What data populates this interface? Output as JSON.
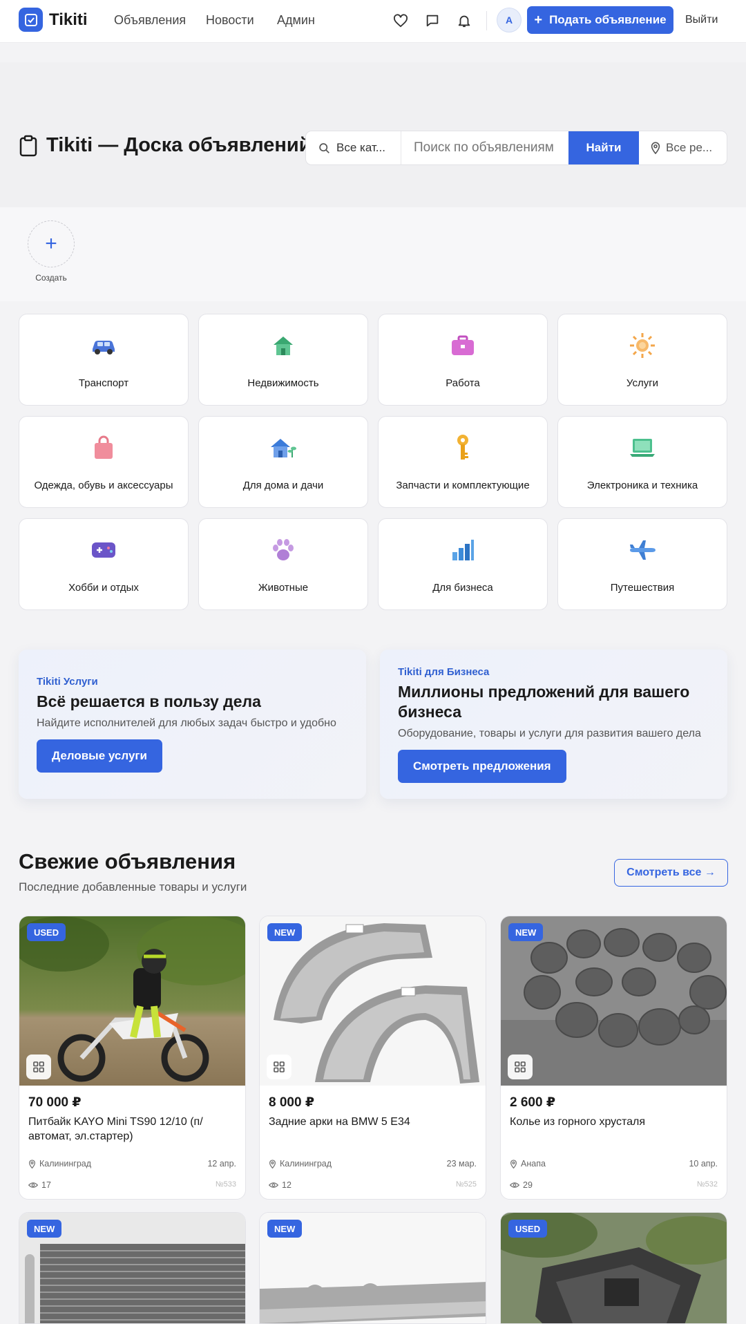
{
  "header": {
    "logo": "Tikiti",
    "nav": [
      "Объявления",
      "Новости",
      "Админ"
    ],
    "avatar": "A",
    "post_button": "Подать объявление",
    "logout": "Выйти"
  },
  "hero": {
    "title": "Tikiti — Доска объявлений",
    "category_select": "Все кат...",
    "search_placeholder": "Поиск по объявлениям",
    "find_button": "Найти",
    "region_select": "Все ре..."
  },
  "stories": {
    "create_label": "Создать"
  },
  "categories": [
    {
      "label": "Транспорт",
      "icon": "car-icon"
    },
    {
      "label": "Недвижимость",
      "icon": "house-icon"
    },
    {
      "label": "Работа",
      "icon": "briefcase-icon"
    },
    {
      "label": "Услуги",
      "icon": "sun-icon"
    },
    {
      "label": "Одежда, обувь и аксессуары",
      "icon": "bag-icon"
    },
    {
      "label": "Для дома и дачи",
      "icon": "garden-house-icon"
    },
    {
      "label": "Запчасти и комплектующие",
      "icon": "key-icon"
    },
    {
      "label": "Электроника и техника",
      "icon": "laptop-icon"
    },
    {
      "label": "Хобби и отдых",
      "icon": "gamepad-icon"
    },
    {
      "label": "Животные",
      "icon": "paw-icon"
    },
    {
      "label": "Для бизнеса",
      "icon": "bar-chart-icon"
    },
    {
      "label": "Путешествия",
      "icon": "airplane-icon"
    }
  ],
  "promos": [
    {
      "tag": "Tikiti Услуги",
      "heading": "Всё решается в пользу дела",
      "desc": "Найдите исполнителей для любых задач быстро и удобно",
      "button": "Деловые услуги"
    },
    {
      "tag": "Tikiti для Бизнеса",
      "heading": "Миллионы предложений для вашего бизнеса",
      "desc": "Оборудование, товары и услуги для развития вашего дела",
      "button": "Смотреть предложения"
    }
  ],
  "fresh": {
    "title": "Свежие объявления",
    "subtitle": "Последние добавленные товары и услуги",
    "see_all": "Смотреть все →",
    "listings": [
      {
        "badge": "USED",
        "price": "70 000 ₽",
        "title": "Питбайк KAYO Mini TS90 12/10 (п/автомат, эл.стартер)",
        "city": "Калининград",
        "date": "12 апр.",
        "views": "17",
        "id": "№533"
      },
      {
        "badge": "NEW",
        "price": "8 000 ₽",
        "title": "Задние арки на BMW 5 E34",
        "city": "Калининград",
        "date": "23 мар.",
        "views": "12",
        "id": "№525"
      },
      {
        "badge": "NEW",
        "price": "2 600 ₽",
        "title": "Колье из горного хрусталя",
        "city": "Анапа",
        "date": "10 апр.",
        "views": "29",
        "id": "№532"
      },
      {
        "badge": "NEW"
      },
      {
        "badge": "NEW"
      },
      {
        "badge": "USED"
      }
    ]
  },
  "colors": {
    "accent": "#3565e0",
    "background": "#f3f3f5"
  }
}
